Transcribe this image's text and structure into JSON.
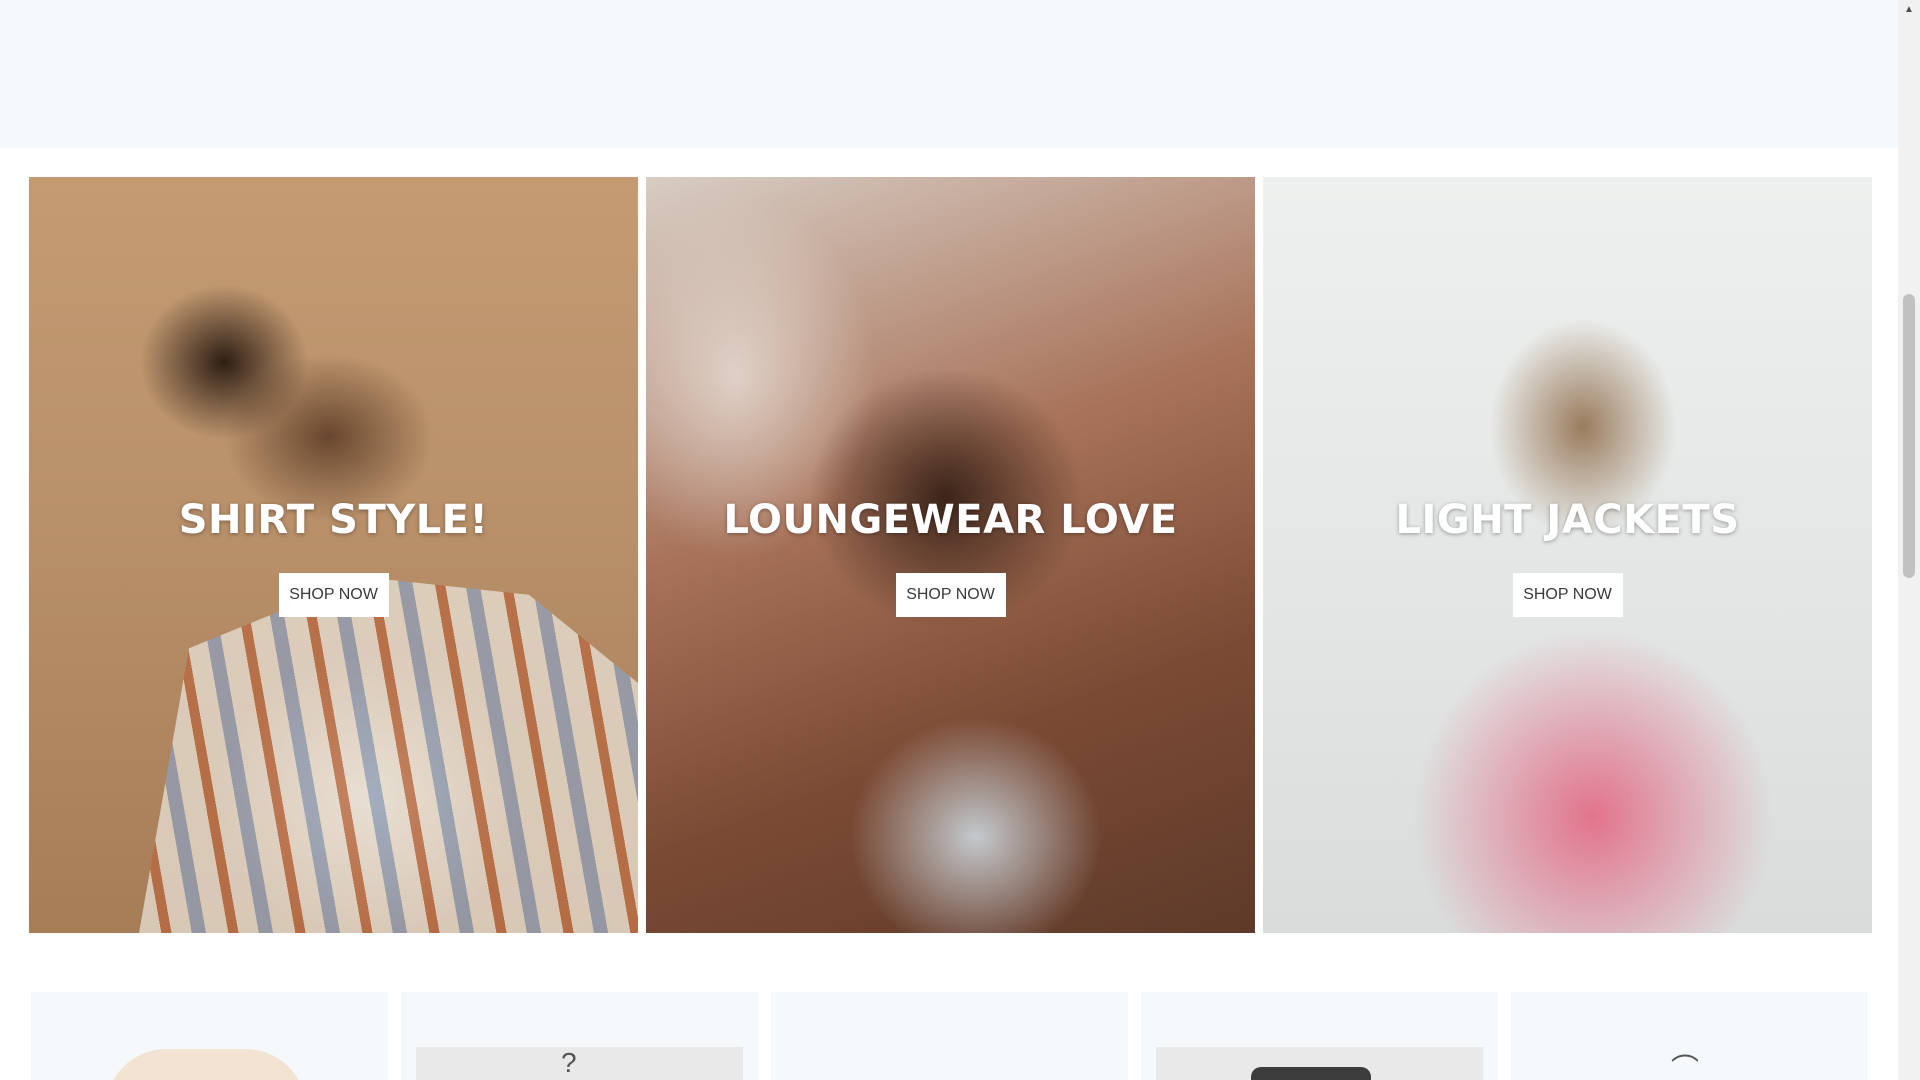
{
  "banners": [
    {
      "title": "SHIRT STYLE!",
      "button_label": "SHOP NOW"
    },
    {
      "title": "LOUNGEWEAR LOVE",
      "button_label": "SHOP NOW"
    },
    {
      "title": "LIGHT JACKETS",
      "button_label": "SHOP NOW"
    }
  ],
  "scrollbar": {
    "up_arrow": "▲"
  },
  "colors": {
    "top_band": "#f5f9fb",
    "button_bg": "#ffffff",
    "title_text": "#ffffff"
  }
}
